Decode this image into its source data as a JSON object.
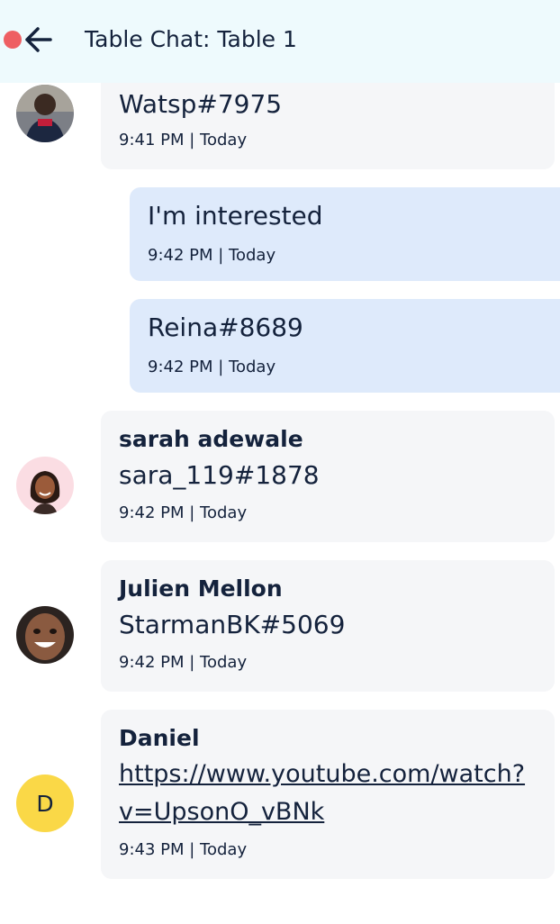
{
  "header": {
    "title": "Table Chat: Table 1",
    "back_icon": "arrow-left-icon",
    "status_color": "#ee5f63"
  },
  "messages": [
    {
      "sender": "",
      "text": "Watsp#7975",
      "time": "9:41 PM | Today",
      "direction": "incoming"
    },
    {
      "text": "I'm interested",
      "time": "9:42 PM | Today",
      "direction": "outgoing"
    },
    {
      "text": "Reina#8689",
      "time": "9:42 PM | Today",
      "direction": "outgoing"
    },
    {
      "sender": "sarah adewale",
      "text": "sara_119#1878",
      "time": "9:42 PM | Today",
      "direction": "incoming"
    },
    {
      "sender": "Julien Mellon",
      "text": "StarmanBK#5069",
      "time": "9:42 PM | Today",
      "direction": "incoming"
    },
    {
      "sender": "Daniel",
      "text_line1": "https://www.youtube.com/watch?",
      "text_line2": "v=UpsonO_vBNk",
      "time": "9:43 PM | Today",
      "direction": "incoming",
      "avatar_letter": "D"
    }
  ],
  "colors": {
    "incoming_bubble": "#f5f6f8",
    "outgoing_bubble": "#deeafb",
    "header_bg": "#eefafd",
    "letter_avatar": "#fad847"
  }
}
